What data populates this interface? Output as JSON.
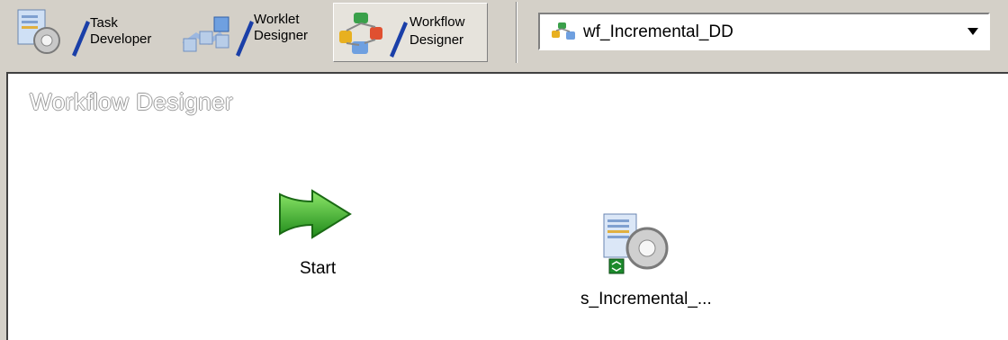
{
  "toolbar": {
    "buttons": [
      {
        "line1": "Task",
        "line2": "Developer",
        "icon": "task-developer-icon"
      },
      {
        "line1": "Worklet",
        "line2": "Designer",
        "icon": "worklet-designer-icon"
      },
      {
        "line1": "Workflow",
        "line2": "Designer",
        "icon": "workflow-designer-icon",
        "active": true
      }
    ]
  },
  "workflow_select": {
    "value": "wf_Incremental_DD",
    "icon": "workflow-icon"
  },
  "canvas": {
    "title": "Workflow Designer",
    "nodes": [
      {
        "label": "Start",
        "icon": "start-arrow-icon"
      },
      {
        "label": "s_Incremental_...",
        "icon": "session-task-icon"
      }
    ]
  }
}
